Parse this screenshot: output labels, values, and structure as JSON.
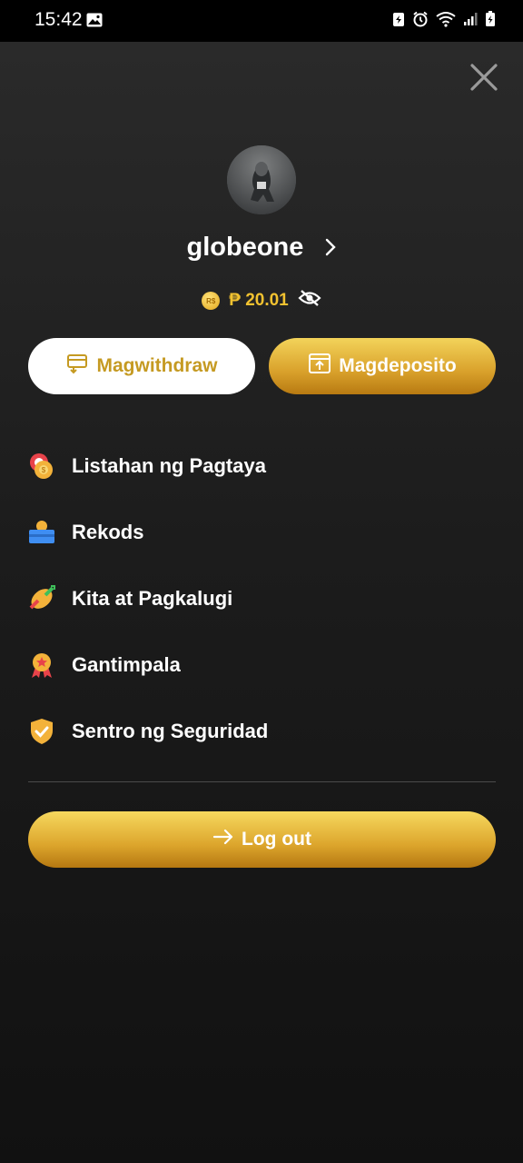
{
  "status_bar": {
    "time": "15:42",
    "icons": [
      "image-icon",
      "battery-saver-icon",
      "alarm-icon",
      "wifi-icon",
      "signal-icon",
      "battery-icon"
    ]
  },
  "profile": {
    "username": "globeone",
    "currency_badge": "R$",
    "balance": "₱ 20.01"
  },
  "actions": {
    "withdraw_label": "Magwithdraw",
    "deposit_label": "Magdeposito"
  },
  "menu": {
    "items": [
      {
        "label": "Listahan ng Pagtaya",
        "icon": "chips-icon"
      },
      {
        "label": "Rekods",
        "icon": "records-icon"
      },
      {
        "label": "Kita at Pagkalugi",
        "icon": "profit-loss-icon"
      },
      {
        "label": "Gantimpala",
        "icon": "medal-icon"
      },
      {
        "label": "Sentro ng Seguridad",
        "icon": "shield-icon"
      }
    ]
  },
  "logout_label": "Log out",
  "colors": {
    "accent_gold": "#f2c230",
    "button_gold": "#dca52c",
    "background": "#1c1c1c"
  }
}
